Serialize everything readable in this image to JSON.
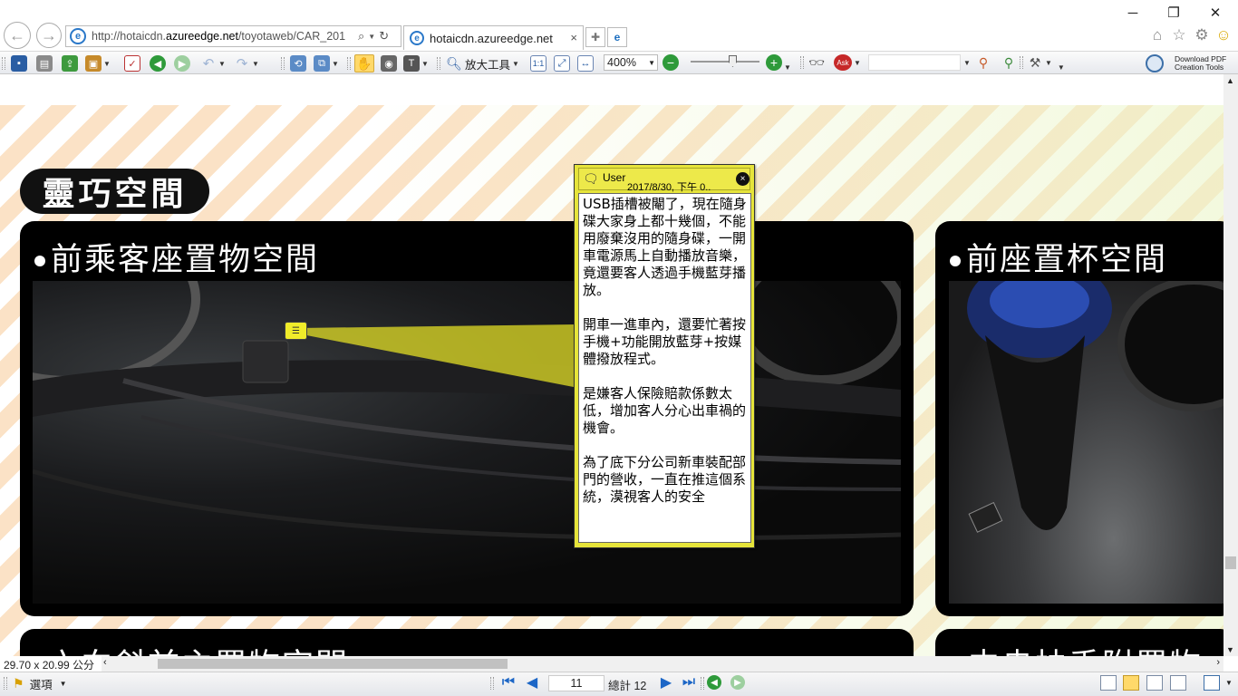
{
  "browser": {
    "url_prefix": "http://hotaicdn.",
    "url_domain": "azureedge.net",
    "url_path": "/toyotaweb/CAR_201",
    "tab_title": "hotaicdn.azureedge.net",
    "tab_close": "×",
    "search_glyph": "⌕",
    "refresh_glyph": "↻"
  },
  "toolbar": {
    "magnify_label": "放大工具",
    "zoom_value": "400%",
    "download_pdf_line1": "Download PDF",
    "download_pdf_line2": "Creation Tools"
  },
  "document": {
    "section_title": "靈巧空間",
    "panel_left_title": "前乘客座置物空間",
    "panel_right_title": "前座置杯空間",
    "panel_bottom_left_title": "六向斜前主置物空間",
    "panel_bottom_right_title": "中央扶手附置物"
  },
  "note": {
    "user": "User",
    "date": "2017/8/30, 下午 0..",
    "close": "×",
    "body": "USB插槽被閹了，現在隨身碟大家身上都十幾個，不能用廢棄沒用的隨身碟，一開車電源馬上自動播放音樂，竟還要客人透過手機藍芽播放。\n\n開車一進車內，還要忙著按手機+功能開放藍芽+按媒體撥放程式。\n\n是嫌客人保險賠款係數太低，增加客人分心出車禍的機會。\n\n為了底下分公司新車裝配部門的營收，一直在推這個系統，漠視客人的安全"
  },
  "status": {
    "page_size": "29.70 x 20.99 公分",
    "options_label": "選項",
    "page_number": "11",
    "page_total": "總計 12"
  },
  "colors": {
    "note_yellow": "#e6e43a",
    "nav_blue": "#1c66c6",
    "nav_green": "#2e9a3a"
  }
}
